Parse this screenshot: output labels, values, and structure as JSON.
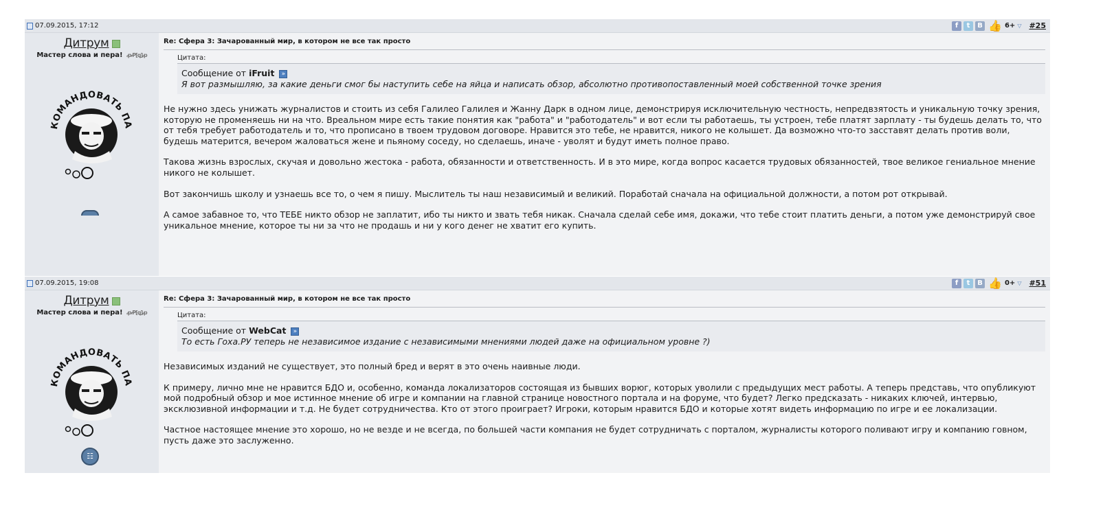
{
  "posts": [
    {
      "date": "07.09.2015, 17:12",
      "rating": "6+",
      "post_number": "#25",
      "username": "Дитрум",
      "user_title": "Мастер слова и пера!",
      "rep_label": "ꝓꝒ[ꝗ]ꝓ",
      "subject": "Re: Сфера 3: Зачарованный мир, в котором не все так просто",
      "quote_label": "Цитата:",
      "quote_prefix": "Сообщение от",
      "quote_author": "iFruit",
      "quote_text": "Я вот размышляю, за какие деньги смог бы наступить себе на яйца и написать обзор, абсолютно противопоставленный моей собственной точке зрения",
      "paragraphs": [
        "Не нужно здесь унижать журналистов и стоить из себя Галилео Галилея и Жанну Дарк в одном лице, демонстрируя исключительную честность, непредвзятость и уникальную точку зрения, которую не променяешь ни на что. Вреальном мире есть такие понятия как \"работа\" и \"работодатель\" и вот если ты работаешь, ты устроен, тебе платят зарплату - ты будешь делать то, что от тебя требует работодатель и то, что прописано в твоем трудовом договоре. Нравится это тебе, не нравится, никого не колышет. Да возможно что-то засставят делать против воли, будешь матерится, вечером жаловаться жене и пьяному соседу, но сделаешь, иначе - уволят и будут иметь полное право.",
        "Такова жизнь взрослых, скучая и довольно жестока - работа, обязанности и ответственность. И в это мире, когда вопрос касается трудовых обязанностей, твое великое гениальное мнение никого не колышет.",
        "Вот закончишь школу и узнаешь все то, о чем я пишу. Мыслитель ты наш независимый и великий. Поработай сначала на официальной должности, а потом рот открывай.",
        "А самое забавное то, что ТЕБЕ никто обзор не заплатит, ибо ты никто и звать тебя никак. Сначала сделай себе имя, докажи, что тебе стоит платить деньги, а потом уже демонстрируй свое уникальное мнение, которое ты ни за что не продашь и ни у кого денег не хватит его купить."
      ]
    },
    {
      "date": "07.09.2015, 19:08",
      "rating": "0+",
      "post_number": "#51",
      "username": "Дитрум",
      "user_title": "Мастер слова и пера!",
      "rep_label": "ꝓꝒ[ꝗ]ꝓ",
      "subject": "Re: Сфера 3: Зачарованный мир, в котором не все так просто",
      "quote_label": "Цитата:",
      "quote_prefix": "Сообщение от",
      "quote_author": "WebCat",
      "quote_text": "То есть Гоха.РУ теперь не независимое издание с независимыми мнениями людей даже на официальном уровне ?)",
      "paragraphs": [
        "Независимых изданий не существует, это полный бред и верят в это очень наивные люди.",
        "К примеру, лично мне не нравится БДО и, особенно, команда локализаторов состоящая из бывших ворюг, которых уволили с предыдущих мест работы. А теперь представь, что опубликуют мой подробный обзор и мое истинное мнение об игре и компании на главной странице новостного портала и на форуме, что будет? Легко предсказать - никаких ключей, интервью, эксклюзивной информации и т.д. Не будет сотрудничества. Кто от этого проиграет? Игроки, которым нравится БДО и которые хотят видеть информацию по игре и ее локализации.",
        "Частное настоящее мнение это хорошо, но не везде и не всегда, по большей части компания не будет сотрудничать с порталом, журналисты которого поливают игру и компанию говном, пусть даже это заслуженно."
      ]
    }
  ],
  "icons": {
    "date": "page-icon",
    "share": [
      "facebook-icon",
      "twitter-icon",
      "vkontakte-icon"
    ],
    "rating_up": "thumbs-up-icon",
    "rating_down": "triangle-down-icon",
    "online": "user-online-icon",
    "goto_quote": "goto-post-icon",
    "badge": "award-badge-icon"
  },
  "colors": {
    "header_bg": "#e3e6eb",
    "user_col_bg": "#e5e8ed",
    "message_bg": "#f2f3f5",
    "quote_bg": "#e9ebef",
    "accent_blue": "#4d7fbf"
  }
}
